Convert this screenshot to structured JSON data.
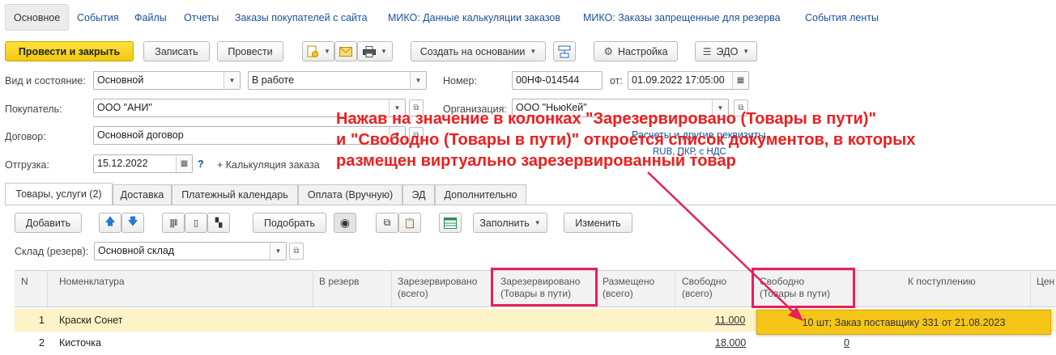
{
  "nav": {
    "active": "Основное",
    "items": [
      "События",
      "Файлы",
      "Отчеты",
      "Заказы покупателей с сайта",
      "МИКО: Данные калькуляции заказов",
      "МИКО: Заказы запрещенные для резерва",
      "События ленты"
    ]
  },
  "toolbar": {
    "post_close": "Провести и закрыть",
    "save": "Записать",
    "post": "Провести",
    "create_based": "Создать на основании",
    "settings": "Настройка",
    "edo": "ЭДО"
  },
  "form": {
    "kind_label": "Вид и состояние:",
    "kind_value": "Основной",
    "state_value": "В работе",
    "number_label": "Номер:",
    "number_value": "00НФ-014544",
    "date_label": "от:",
    "date_value": "01.09.2022 17:05:00",
    "buyer_label": "Покупатель:",
    "buyer_value": "ООО \"АНИ\"",
    "org_label": "Организация:",
    "org_value": "ООО \"НьюКей\"",
    "contract_label": "Договор:",
    "contract_value": "Основной договор",
    "contract_link": "Расчеты и другие реквизиты",
    "currency_info": "RUB, ПКР, с НДС",
    "shipment_label": "Отгрузка:",
    "shipment_value": "15.12.2022",
    "help": "?",
    "calc_link": "+ Калькуляция заказа"
  },
  "tabs": [
    "Товары, услуги (2)",
    "Доставка",
    "Платежный календарь",
    "Оплата (Вручную)",
    "ЭД",
    "Дополнительно"
  ],
  "table_toolbar": {
    "add": "Добавить",
    "pick": "Подобрать",
    "fill": "Заполнить",
    "change": "Изменить"
  },
  "warehouse": {
    "label": "Склад (резерв):",
    "value": "Основной склад"
  },
  "columns": {
    "n": "N",
    "item": "Номенклатура",
    "reserve": "В резерв",
    "reserved_total_1": "Зарезервировано",
    "reserved_total_2": "(всего)",
    "reserved_transit_1": "Зарезервировано",
    "reserved_transit_2": "(Товары в пути)",
    "placed_1": "Размещено",
    "placed_2": "(всего)",
    "free_1": "Свободно",
    "free_2": "(всего)",
    "free_transit_1": "Свободно",
    "free_transit_2": "(Товары в пути)",
    "incoming": "К поступлению",
    "price": "Цен"
  },
  "rows": [
    {
      "n": "1",
      "item": "Краски Сонет",
      "free": "11.000",
      "free_transit": ""
    },
    {
      "n": "2",
      "item": "Кисточка",
      "free": "18.000",
      "free_transit": "0"
    }
  ],
  "popup": "10 шт; Заказ поставщику 331 от 21.08.2023",
  "annotation": {
    "line1": "Нажав на значение в колонках \"Зарезервировано (Товары в пути)\"",
    "line2": "и \"Свободно (Товары в пути)\" откроется список документов, в которых",
    "line3": "размещен виртуально зарезервированный товар"
  },
  "colors": {
    "accent_yellow": "#f2c80f",
    "highlight_pink": "#e8205a",
    "annotation_red": "#ee1e1e",
    "link_blue": "#1a4f9c",
    "row_selected": "#fdf3c6"
  }
}
